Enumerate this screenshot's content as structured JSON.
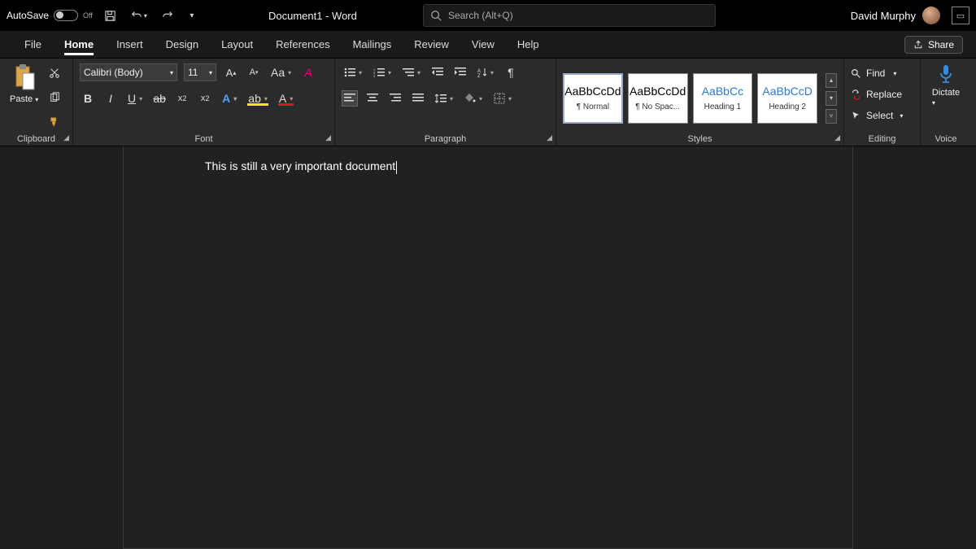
{
  "titlebar": {
    "autosave_label": "AutoSave",
    "autosave_state": "Off",
    "document_title": "Document1  -  Word",
    "search_placeholder": "Search (Alt+Q)",
    "user_name": "David Murphy"
  },
  "tabs": {
    "file": "File",
    "home": "Home",
    "insert": "Insert",
    "design": "Design",
    "layout": "Layout",
    "references": "References",
    "mailings": "Mailings",
    "review": "Review",
    "view": "View",
    "help": "Help",
    "share": "Share"
  },
  "ribbon": {
    "clipboard": {
      "label": "Clipboard",
      "paste": "Paste"
    },
    "font": {
      "label": "Font",
      "family": "Calibri (Body)",
      "size": "11"
    },
    "paragraph": {
      "label": "Paragraph"
    },
    "styles": {
      "label": "Styles",
      "items": [
        {
          "preview": "AaBbCcDd",
          "name": "¶ Normal",
          "blue": false
        },
        {
          "preview": "AaBbCcDd",
          "name": "¶ No Spac...",
          "blue": false
        },
        {
          "preview": "AaBbCc",
          "name": "Heading 1",
          "blue": true
        },
        {
          "preview": "AaBbCcD",
          "name": "Heading 2",
          "blue": true
        }
      ]
    },
    "editing": {
      "label": "Editing",
      "find": "Find",
      "replace": "Replace",
      "select": "Select"
    },
    "voice": {
      "label": "Voice",
      "dictate": "Dictate"
    }
  },
  "document": {
    "text": "This is still a very important document"
  }
}
